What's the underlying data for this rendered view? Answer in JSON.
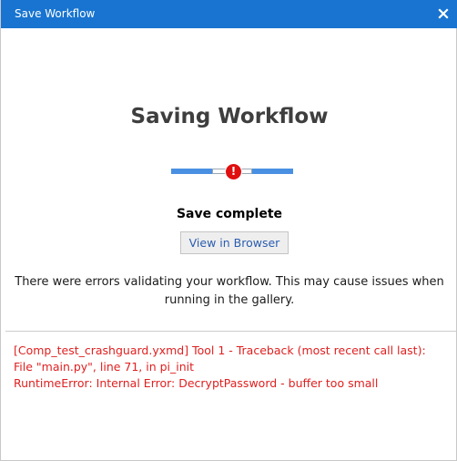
{
  "window": {
    "title": "Save Workflow",
    "close_glyph": "×"
  },
  "main": {
    "heading": "Saving Workflow",
    "progress_state": "error",
    "error_glyph": "!",
    "status": "Save complete",
    "view_button": "View in Browser",
    "message": "There were errors validating your workflow. This may cause issues when running in the gallery."
  },
  "errors": [
    "[Comp_test_crashguard.yxmd] Tool 1 - Traceback (most recent call last):",
    "File \"main.py\", line 71, in pi_init",
    "RuntimeError: Internal Error: DecryptPassword - buffer too small"
  ],
  "icons": {
    "close": "close-icon",
    "error": "error-icon"
  },
  "colors": {
    "titlebar": "#1874d0",
    "progress": "#4a90e2",
    "error": "#e02020",
    "link": "#2a5db0"
  }
}
